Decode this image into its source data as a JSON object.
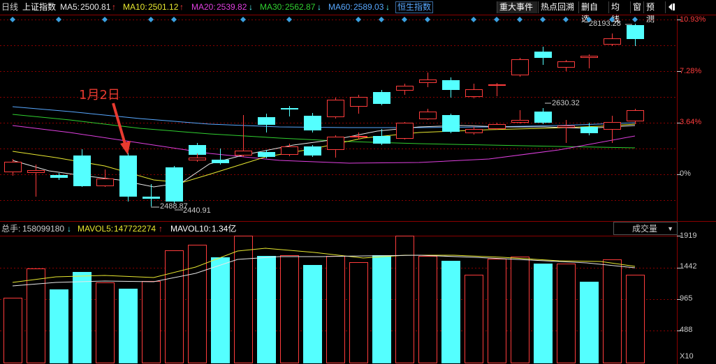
{
  "header": {
    "period": "日线",
    "index_name": "上证指数",
    "ma5": {
      "label": "MA5:",
      "value": "2500.81",
      "arrow": "↑",
      "color": "#e8e8e8"
    },
    "ma10": {
      "label": "MA10:",
      "value": "2501.12",
      "arrow": "↑",
      "color": "#e8e830"
    },
    "ma20": {
      "label": "MA20:",
      "value": "2539.82",
      "arrow": "↓",
      "color": "#e040e0"
    },
    "ma30": {
      "label": "MA30:",
      "value": "2562.87",
      "arrow": "↓",
      "color": "#30d030"
    },
    "ma60": {
      "label": "MA60:",
      "value": "2589.03",
      "arrow": "↓",
      "color": "#58a8ff"
    },
    "linked_index": "恒生指数"
  },
  "toolbar": {
    "events": "重大事件",
    "hot_review": "热点回溯",
    "delete_watch": "删自选",
    "ma_line": "均线",
    "window": "窗",
    "forecast": "预测"
  },
  "price_axis": [
    "10.93%",
    "7.28%",
    "3.64%",
    "0%"
  ],
  "annotations": {
    "date_label": "1月2日",
    "high_label": "28193.28",
    "mid_label": "2630.32",
    "low_label1": "2488.87",
    "low_label2": "2440.91"
  },
  "volume_header": {
    "total_label": "总手:",
    "total_value": "158099180",
    "total_arrow": "↓",
    "mavol5_label": "MAVOL5:",
    "mavol5_value": "147722274",
    "mavol5_arrow": "↑",
    "mavol10_label": "MAVOL10:",
    "mavol10_value": "1.34亿"
  },
  "volume_indicator": "成交量",
  "volume_axis": [
    "1919",
    "1442",
    "965",
    "488"
  ],
  "volume_unit": "X10",
  "colors": {
    "up": "#ff3c3c",
    "down": "#54ffff",
    "grid": "#8b0000"
  }
}
